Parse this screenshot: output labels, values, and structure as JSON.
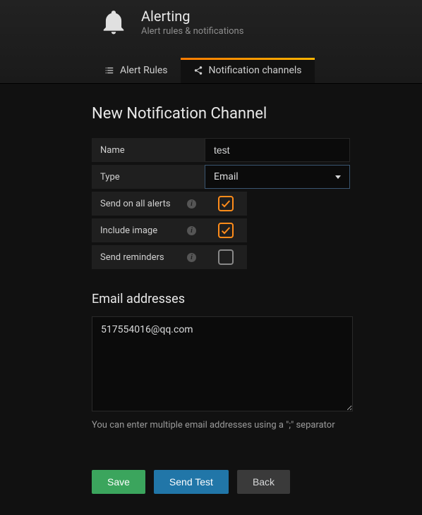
{
  "header": {
    "title": "Alerting",
    "subtitle": "Alert rules & notifications"
  },
  "tabs": {
    "alert_rules": "Alert Rules",
    "notification_channels": "Notification channels"
  },
  "page": {
    "heading": "New Notification Channel"
  },
  "form": {
    "name_label": "Name",
    "name_value": "test",
    "type_label": "Type",
    "type_value": "Email",
    "send_all_label": "Send on all alerts",
    "send_all_checked": true,
    "include_image_label": "Include image",
    "include_image_checked": true,
    "send_reminders_label": "Send reminders",
    "send_reminders_checked": false
  },
  "email": {
    "section_title": "Email addresses",
    "value": "517554016@qq.com",
    "helper": "You can enter multiple email addresses using a \";\" separator"
  },
  "buttons": {
    "save": "Save",
    "send_test": "Send Test",
    "back": "Back"
  }
}
